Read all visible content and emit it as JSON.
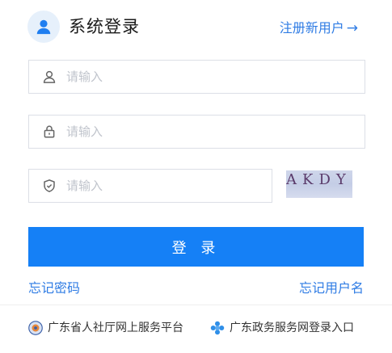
{
  "header": {
    "title": "系统登录",
    "register_link": "注册新用户",
    "register_arrow": "→"
  },
  "form": {
    "username_placeholder": "请输入",
    "password_placeholder": "请输入",
    "captcha_placeholder": "请输入",
    "captcha_text": "AKDY",
    "login_label": "登 录"
  },
  "links": {
    "forgot_password": "忘记密码",
    "forgot_username": "忘记用户名"
  },
  "footer": {
    "hrss_platform": "广东省人社厅网上服务平台",
    "gov_service": "广东政务服务网登录入口"
  },
  "colors": {
    "primary": "#1580f6",
    "link": "#2f7ce4"
  }
}
